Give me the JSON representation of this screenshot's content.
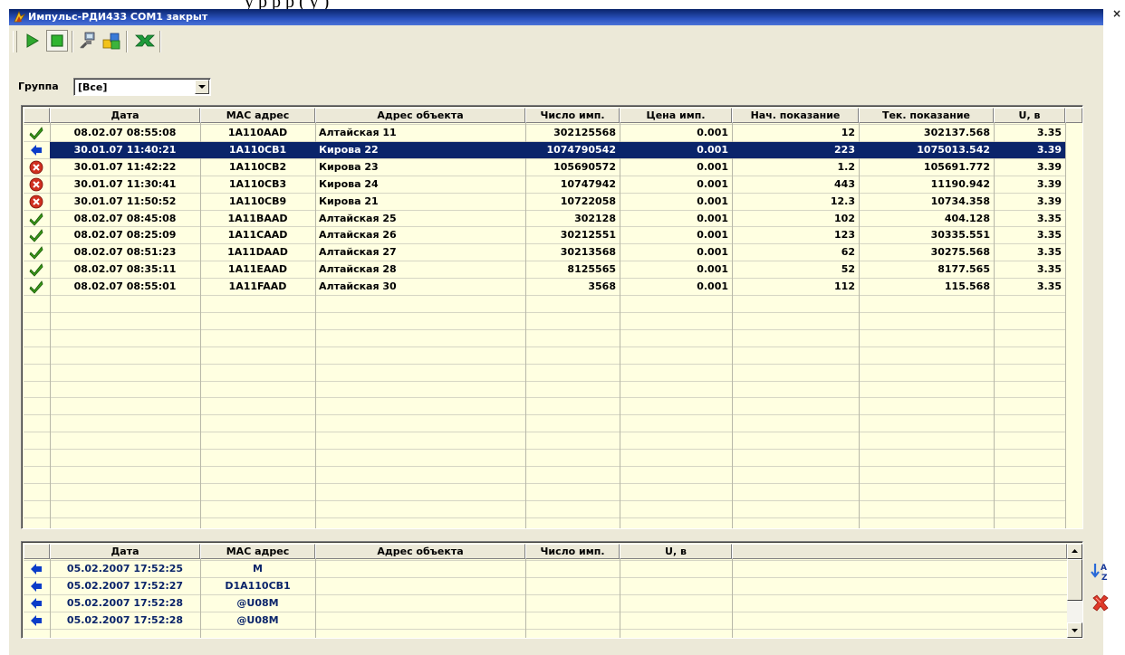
{
  "page": {
    "top_text": "у            р                                                             р    р        (          у        )",
    "close_glyph": "×"
  },
  "window": {
    "title": "Импульс-РДИ433 COM1 закрыт",
    "icons": [
      "app-icon"
    ]
  },
  "toolbar": {
    "buttons": [
      {
        "name": "play-icon"
      },
      {
        "name": "stop-icon",
        "pressed": true
      },
      {
        "name": "connect-icon"
      },
      {
        "name": "cubes-icon"
      },
      {
        "name": "excel-export-icon"
      }
    ]
  },
  "group": {
    "label": "Группа",
    "value": "[Все]"
  },
  "main_table": {
    "columns": [
      "Дата",
      "МАС адрес",
      "Адрес объекта",
      "Число имп.",
      "Цена имп.",
      "Нач. показание",
      "Тек. показание",
      "U, в"
    ],
    "selected_row": 1,
    "selection_color": "#0A246A",
    "rows": [
      {
        "status": "check-icon",
        "date": "08.02.07 08:55:08",
        "mac": "1A110AAD",
        "address": "Алтайская 11",
        "pulses": "302125568",
        "price": "0.001",
        "start": "12",
        "current": "302137.568",
        "u": "3.35"
      },
      {
        "status": "arrow-left-icon",
        "date": "30.01.07 11:40:21",
        "mac": "1A110CB1",
        "address": "Кирова 22",
        "pulses": "1074790542",
        "price": "0.001",
        "start": "223",
        "current": "1075013.542",
        "u": "3.39"
      },
      {
        "status": "error-icon",
        "date": "30.01.07 11:42:22",
        "mac": "1A110CB2",
        "address": "Кирова 23",
        "pulses": "105690572",
        "price": "0.001",
        "start": "1.2",
        "current": "105691.772",
        "u": "3.39"
      },
      {
        "status": "error-icon",
        "date": "30.01.07 11:30:41",
        "mac": "1A110CB3",
        "address": "Кирова 24",
        "pulses": "10747942",
        "price": "0.001",
        "start": "443",
        "current": "11190.942",
        "u": "3.39"
      },
      {
        "status": "error-icon",
        "date": "30.01.07 11:50:52",
        "mac": "1A110CB9",
        "address": "Кирова 21",
        "pulses": "10722058",
        "price": "0.001",
        "start": "12.3",
        "current": "10734.358",
        "u": "3.39"
      },
      {
        "status": "check-icon",
        "date": "08.02.07 08:45:08",
        "mac": "1A11BAAD",
        "address": "Алтайская 25",
        "pulses": "302128",
        "price": "0.001",
        "start": "102",
        "current": "404.128",
        "u": "3.35"
      },
      {
        "status": "check-icon",
        "date": "08.02.07 08:25:09",
        "mac": "1A11CAAD",
        "address": "Алтайская 26",
        "pulses": "30212551",
        "price": "0.001",
        "start": "123",
        "current": "30335.551",
        "u": "3.35"
      },
      {
        "status": "check-icon",
        "date": "08.02.07 08:51:23",
        "mac": "1A11DAAD",
        "address": "Алтайская 27",
        "pulses": "30213568",
        "price": "0.001",
        "start": "62",
        "current": "30275.568",
        "u": "3.35"
      },
      {
        "status": "check-icon",
        "date": "08.02.07 08:35:11",
        "mac": "1A11EAAD",
        "address": "Алтайская 28",
        "pulses": "8125565",
        "price": "0.001",
        "start": "52",
        "current": "8177.565",
        "u": "3.35"
      },
      {
        "status": "check-icon",
        "date": "08.02.07 08:55:01",
        "mac": "1A11FAAD",
        "address": "Алтайская 30",
        "pulses": "3568",
        "price": "0.001",
        "start": "112",
        "current": "115.568",
        "u": "3.35"
      }
    ]
  },
  "log_table": {
    "columns": [
      "Дата",
      "МАС адрес",
      "Адрес объекта",
      "Число имп.",
      "U, в"
    ],
    "text_color": "#0A246A",
    "rows": [
      {
        "status": "arrow-left-icon",
        "date": "05.02.2007 17:52:25",
        "mac": "M"
      },
      {
        "status": "arrow-left-icon",
        "date": "05.02.2007 17:52:27",
        "mac": "D1A110CB1"
      },
      {
        "status": "arrow-left-icon",
        "date": "05.02.2007 17:52:28",
        "mac": "@U08M"
      },
      {
        "status": "arrow-left-icon",
        "date": "05.02.2007 17:52:28",
        "mac": "@U08M"
      }
    ]
  },
  "side_buttons": [
    {
      "name": "sort-az-icon"
    },
    {
      "name": "delete-icon"
    }
  ],
  "colors": {
    "window_bg": "#ECE9D8",
    "grid_bg": "#FFFFE1",
    "check_green": "#3A9A18",
    "error_red": "#D03020",
    "arrow_blue": "#0A3CC8"
  }
}
